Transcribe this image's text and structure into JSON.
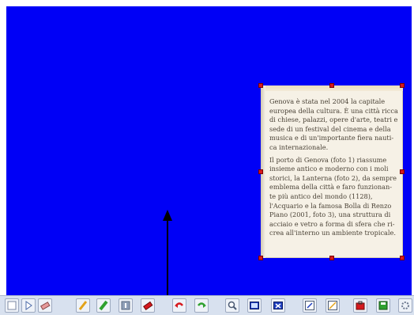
{
  "canvas": {
    "background": "#0000f6"
  },
  "note": {
    "paragraphs": [
      "Genova è stata nel 2004 la capitale\neuropea della cultura. È una città ricca\ndi chiese, palazzi, opere d'arte, teatri e\nsede di un festival del cinema e della\nmusica e di un'importante fiera nauti-\nca internazionale.",
      "Il porto di Genova (foto 1) riassume\ninsieme antico e moderno con i moli\nstorici, la Lanterna (foto 2), da sempre\nemblema della città e faro funzionan-\nte più antico del mondo (1128),\nl'Acquario e la famosa Bolla di Renzo\nPiano (2001, foto 3), una struttura di\nacciaio e vetro a forma di sfera che ri-\ncrea all'interno un ambiente tropicale."
    ]
  },
  "toolbar": {
    "tools": [
      {
        "icon": "page-icon"
      },
      {
        "icon": "play-icon"
      },
      {
        "icon": "eraser-icon"
      },
      {
        "icon": "pen-icon"
      },
      {
        "icon": "highlighter-icon"
      },
      {
        "icon": "text-icon"
      },
      {
        "icon": "eraser-red-icon"
      },
      {
        "icon": "undo-icon"
      },
      {
        "icon": "redo-icon"
      },
      {
        "icon": "zoom-icon"
      },
      {
        "icon": "screen-icon"
      },
      {
        "icon": "close-window-icon"
      },
      {
        "icon": "edit-icon"
      },
      {
        "icon": "line-icon"
      },
      {
        "icon": "toolbox-icon"
      },
      {
        "icon": "save-icon"
      },
      {
        "icon": "settings-icon"
      }
    ]
  }
}
